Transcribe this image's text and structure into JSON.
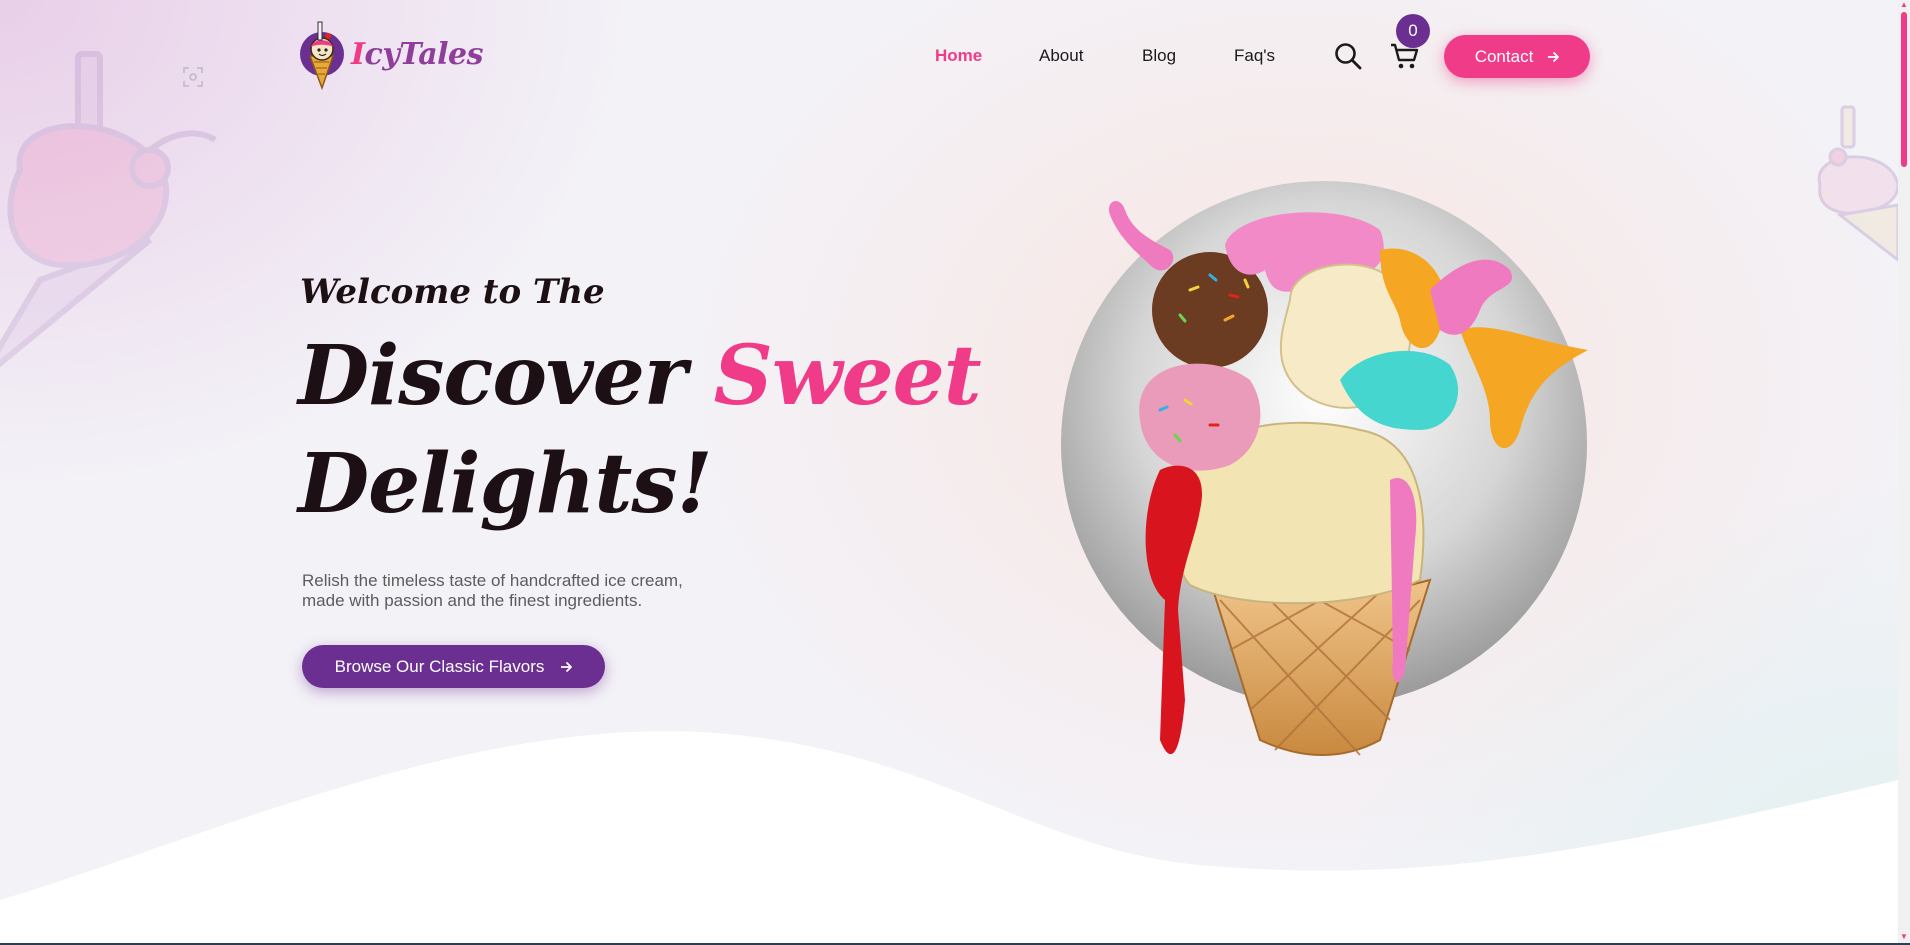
{
  "brand": {
    "name_first": "I",
    "name_rest": "cyTales"
  },
  "nav": {
    "items": [
      {
        "label": "Home",
        "active": true
      },
      {
        "label": "About",
        "active": false
      },
      {
        "label": "Blog",
        "active": false
      },
      {
        "label": "Faq's",
        "active": false
      }
    ]
  },
  "header": {
    "search_icon": "search-icon",
    "cart_icon": "cart-icon",
    "cart_count": "0",
    "contact_label": "Contact"
  },
  "hero": {
    "welcome": "Welcome to The",
    "headline_part1": "Discover",
    "headline_accent": "Sweet",
    "headline_part2": "Delights!",
    "description_line1": "Relish the timeless taste of handcrafted ice cream,",
    "description_line2": "made with passion and the finest ingredients.",
    "cta_label": "Browse Our Classic Flavors"
  },
  "colors": {
    "primary_pink": "#ef3b88",
    "primary_purple": "#6b2f91",
    "heading": "#1c1014",
    "text_muted": "#5c5c5c"
  }
}
